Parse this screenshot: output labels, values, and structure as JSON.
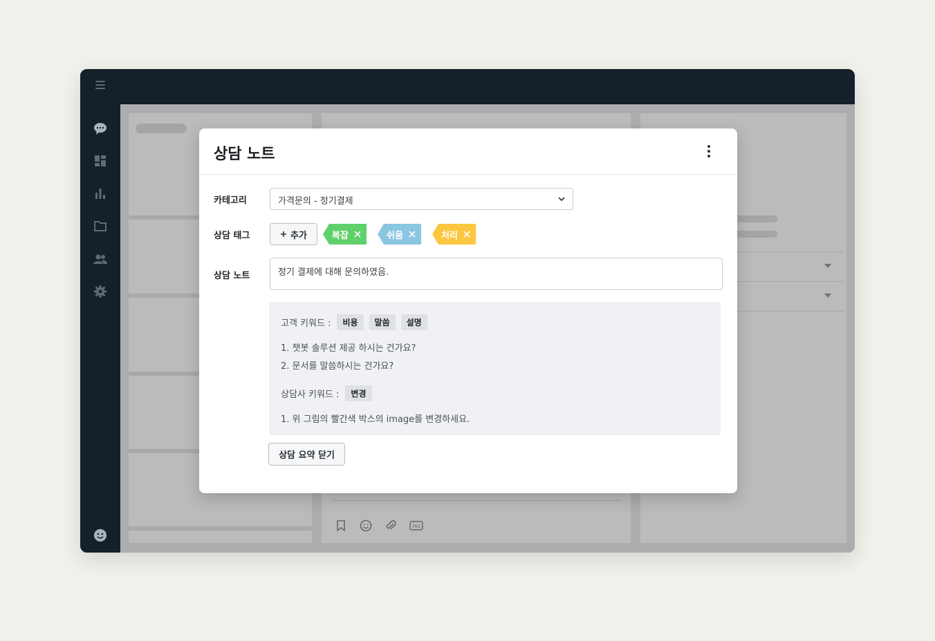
{
  "modal": {
    "title": "상담 노트",
    "more_icon": "kebab-vertical-icon",
    "category": {
      "label": "카테고리",
      "value": "가격문의 - 정기결제"
    },
    "tags": {
      "label": "상담 태그",
      "add_label": "추가",
      "items": [
        {
          "label": "복잡",
          "color": "#5fd16a"
        },
        {
          "label": "쉬움",
          "color": "#8ac6e2"
        },
        {
          "label": "처리",
          "color": "#fcc73f"
        }
      ]
    },
    "note": {
      "label": "상담 노트",
      "value": "정기 결제에 대해 문의하였음."
    },
    "summary": {
      "customer_keywords_label": "고객 키워드 :",
      "customer_keywords": [
        "비용",
        "말씀",
        "설명"
      ],
      "customer_lines": [
        "1. 챗봇 솔루션 제공 하시는 건가요?",
        "2. 문서를 말씀하시는 건가요?"
      ],
      "agent_keywords_label": "상담사 키워드 :",
      "agent_keywords": [
        "변경"
      ],
      "agent_lines": [
        "1. 위 그림의 빨간색 박스의 image를 변경하세요."
      ]
    },
    "close_summary_label": "상담 요약 닫기"
  },
  "sidebar": {
    "icons": [
      "chat-icon",
      "dashboard-icon",
      "stats-icon",
      "folder-icon",
      "users-icon",
      "settings-icon",
      "profile-icon"
    ]
  },
  "composer_icons": [
    "bookmark-icon",
    "emoji-icon",
    "attachment-icon",
    "faq-icon"
  ],
  "colors": {
    "sidebar": "#14202a",
    "background": "#f2f0eb"
  }
}
